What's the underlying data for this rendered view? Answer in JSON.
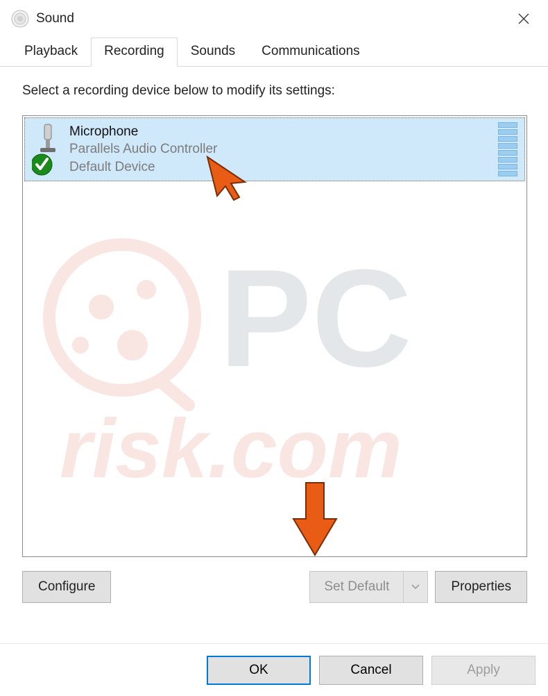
{
  "window": {
    "title": "Sound"
  },
  "tabs": [
    "Playback",
    "Recording",
    "Sounds",
    "Communications"
  ],
  "active_tab_index": 1,
  "instruction": "Select a recording device below to modify its settings:",
  "device": {
    "name": "Microphone",
    "driver": "Parallels Audio Controller",
    "status": "Default Device"
  },
  "buttons": {
    "configure": "Configure",
    "set_default": "Set Default",
    "properties": "Properties",
    "ok": "OK",
    "cancel": "Cancel",
    "apply": "Apply"
  }
}
